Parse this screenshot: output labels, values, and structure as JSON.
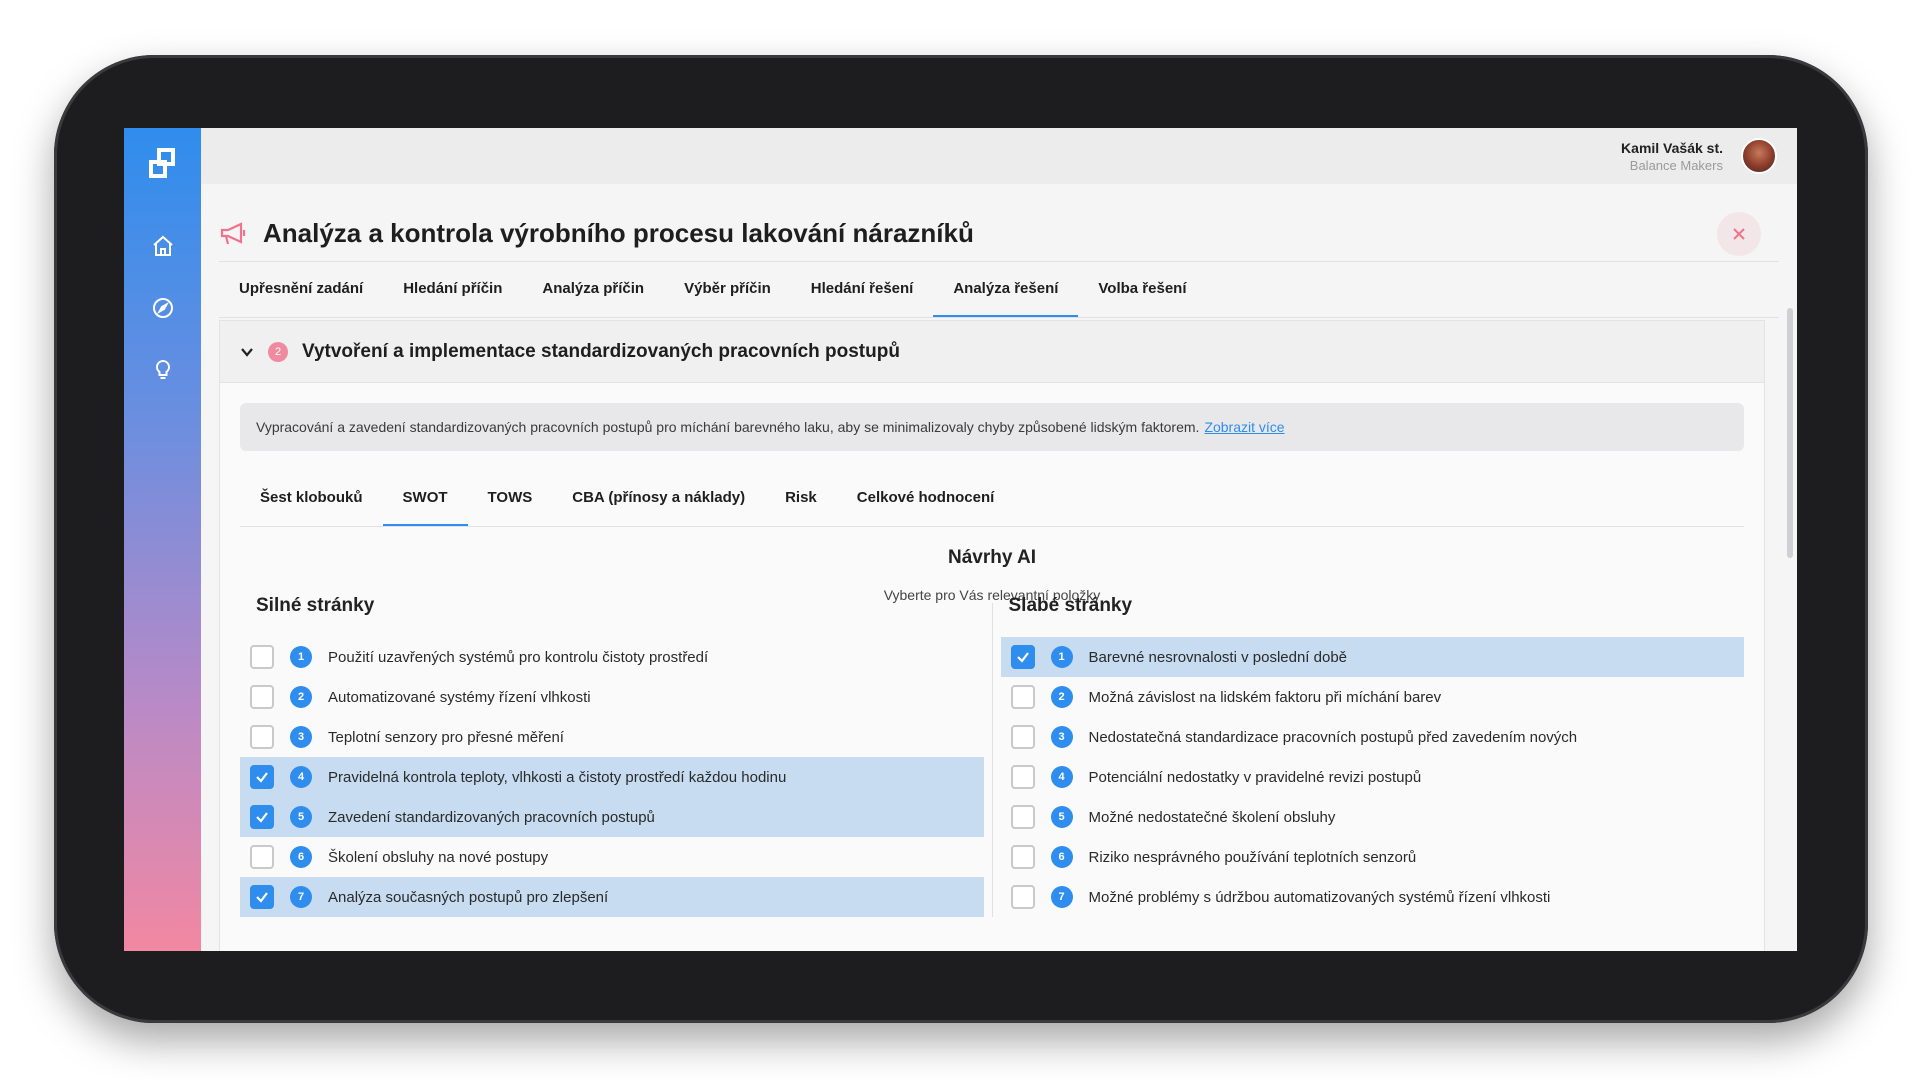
{
  "user": {
    "name": "Kamil Vašák st.",
    "org": "Balance Makers"
  },
  "page": {
    "title": "Analýza a kontrola výrobního procesu lakování nárazníků"
  },
  "tabs": [
    "Upřesnění zadání",
    "Hledání příčin",
    "Analýza příčin",
    "Výběr příčin",
    "Hledání řešení",
    "Analýza řešení",
    "Volba řešení"
  ],
  "active_tab": "Analýza řešení",
  "section": {
    "number": "2",
    "title": "Vytvoření a implementace standardizovaných pracovních postupů",
    "description": "Vypracování a zavedení standardizovaných pracovních postupů pro míchání barevného laku, aby se minimalizovaly chyby způsobené lidským faktorem.",
    "link": "Zobrazit více"
  },
  "subtabs": [
    "Šest klobouků",
    "SWOT",
    "TOWS",
    "CBA (přínosy a náklady)",
    "Risk",
    "Celkové hodnocení"
  ],
  "active_subtab": "SWOT",
  "ai": {
    "title": "Návrhy AI",
    "subtitle": "Vyberte pro Vás relevantní položky"
  },
  "strengths": {
    "title": "Silné stránky",
    "items": [
      {
        "num": "1",
        "label": "Použití uzavřených systémů pro kontrolu čistoty prostředí",
        "checked": false
      },
      {
        "num": "2",
        "label": "Automatizované systémy řízení vlhkosti",
        "checked": false
      },
      {
        "num": "3",
        "label": "Teplotní senzory pro přesné měření",
        "checked": false
      },
      {
        "num": "4",
        "label": "Pravidelná kontrola teploty, vlhkosti a čistoty prostředí každou hodinu",
        "checked": true
      },
      {
        "num": "5",
        "label": "Zavedení standardizovaných pracovních postupů",
        "checked": true
      },
      {
        "num": "6",
        "label": "Školení obsluhy na nové postupy",
        "checked": false
      },
      {
        "num": "7",
        "label": "Analýza současných postupů pro zlepšení",
        "checked": true
      }
    ]
  },
  "weaknesses": {
    "title": "Slabé stránky",
    "items": [
      {
        "num": "1",
        "label": "Barevné nesrovnalosti v poslední době",
        "checked": true
      },
      {
        "num": "2",
        "label": "Možná závislost na lidském faktoru při míchání barev",
        "checked": false
      },
      {
        "num": "3",
        "label": "Nedostatečná standardizace pracovních postupů před zavedením nových",
        "checked": false
      },
      {
        "num": "4",
        "label": "Potenciální nedostatky v pravidelné revizi postupů",
        "checked": false
      },
      {
        "num": "5",
        "label": "Možné nedostatečné školení obsluhy",
        "checked": false
      },
      {
        "num": "6",
        "label": "Riziko nesprávného používání teplotních senzorů",
        "checked": false
      },
      {
        "num": "7",
        "label": "Možné problémy s údržbou automatizovaných systémů řízení vlhkosti",
        "checked": false
      }
    ]
  },
  "colors": {
    "accent": "#2f8ded",
    "selected_row": "#c7dcf0",
    "badge_pink": "#f08aa0"
  }
}
